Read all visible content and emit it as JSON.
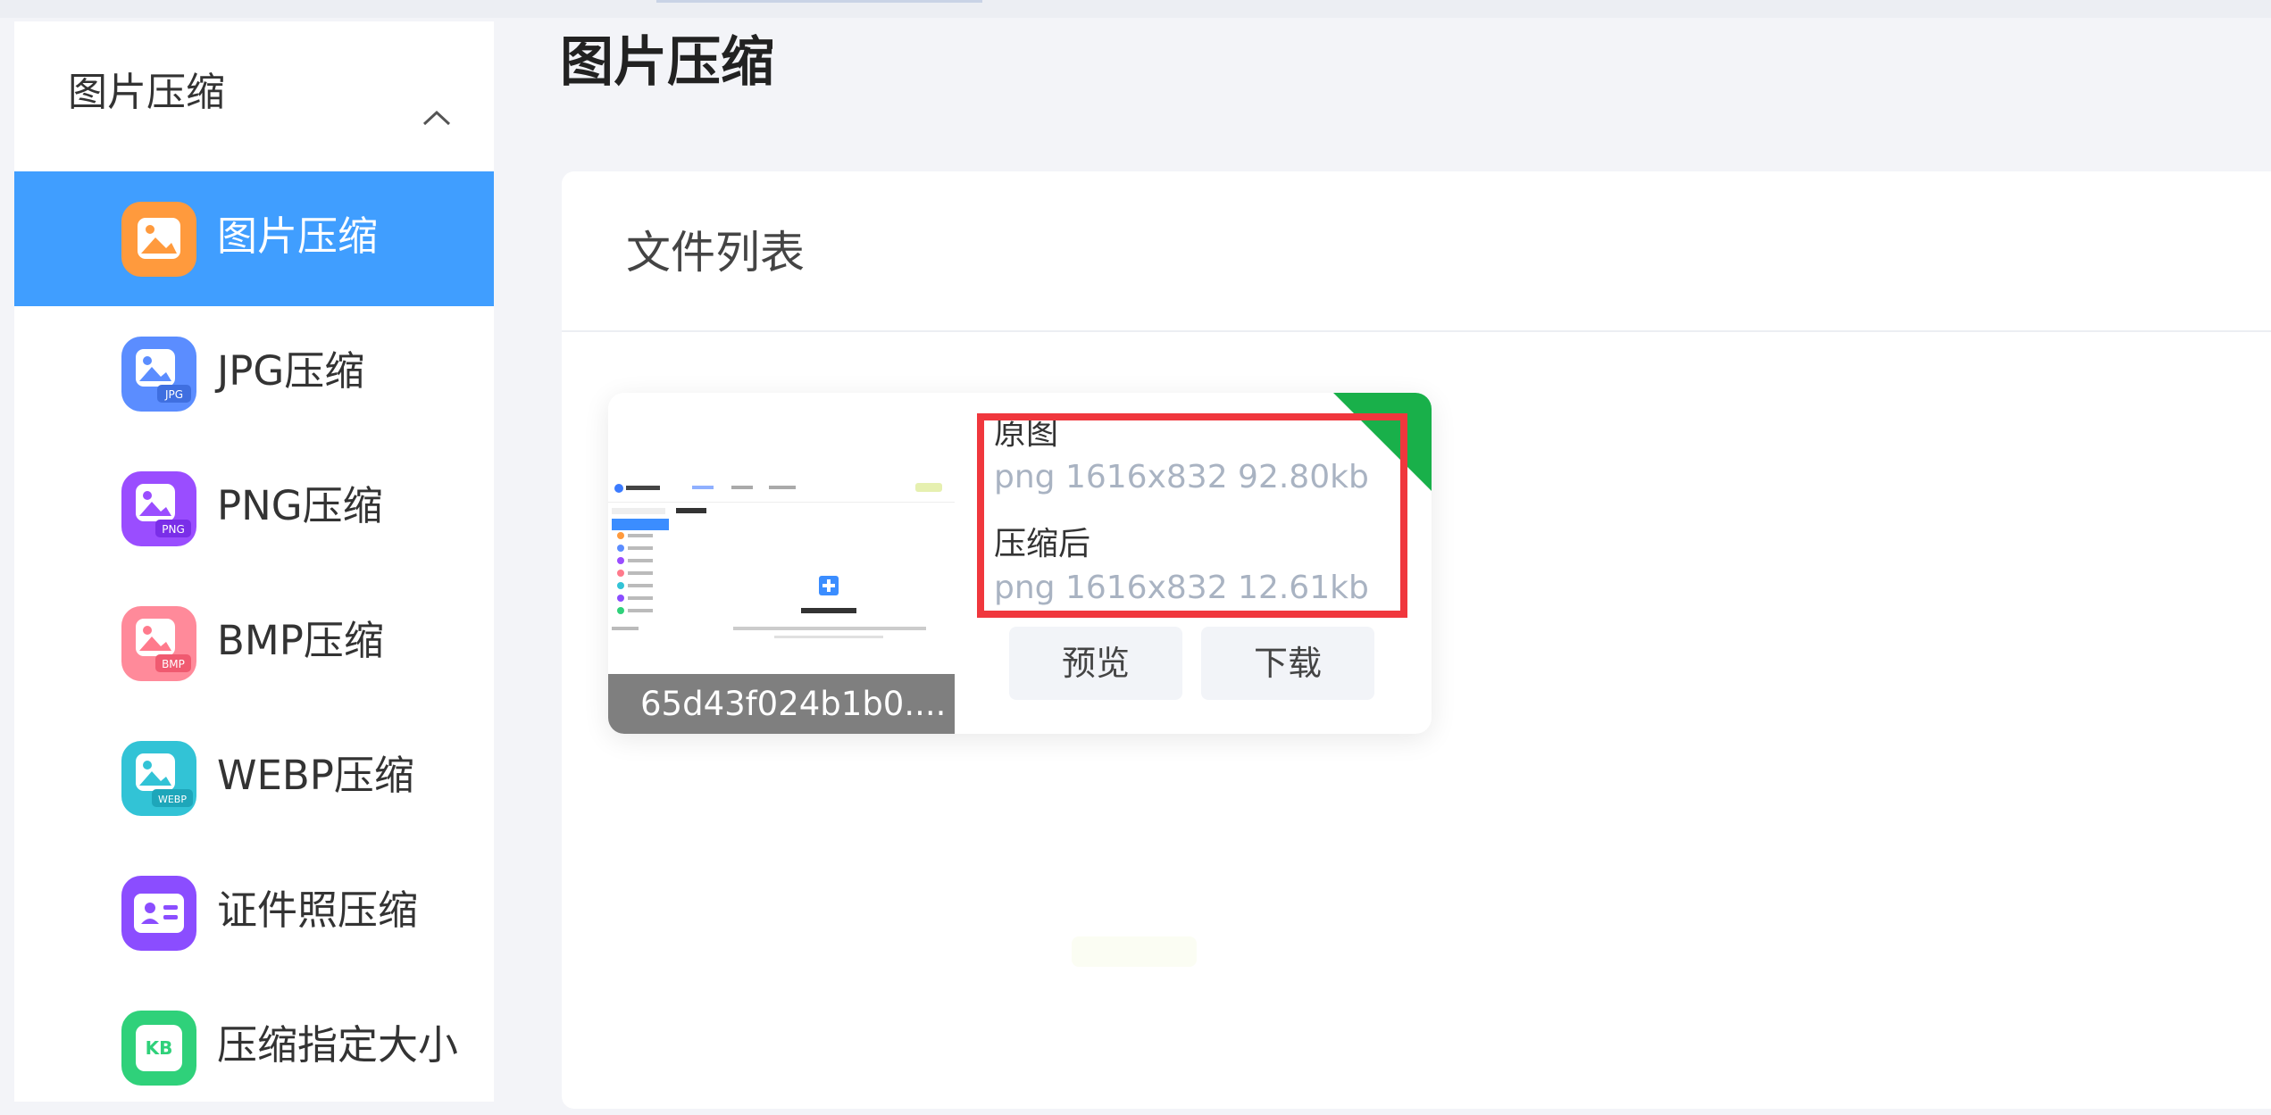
{
  "sidebar": {
    "header_title": "图片压缩",
    "items": [
      {
        "label": "图片压缩",
        "icon": "image-compress-icon",
        "badge": "",
        "color": "#ff9a3d",
        "active": true
      },
      {
        "label": "JPG压缩",
        "icon": "jpg-compress-icon",
        "badge": "JPG",
        "color": "#5b8dff",
        "active": false
      },
      {
        "label": "PNG压缩",
        "icon": "png-compress-icon",
        "badge": "PNG",
        "color": "#9a4dff",
        "active": false
      },
      {
        "label": "BMP压缩",
        "icon": "bmp-compress-icon",
        "badge": "BMP",
        "color": "#ff7a8c",
        "active": false
      },
      {
        "label": "WEBP压缩",
        "icon": "webp-compress-icon",
        "badge": "WEBP",
        "color": "#32c3d6",
        "active": false
      },
      {
        "label": "证件照压缩",
        "icon": "id-photo-compress-icon",
        "badge": "",
        "color": "#8b4dff",
        "active": false
      },
      {
        "label": "压缩指定大小",
        "icon": "size-compress-icon",
        "badge": "KB",
        "color": "#2fd17a",
        "active": false
      }
    ]
  },
  "main": {
    "title": "图片压缩",
    "panel_title": "文件列表",
    "file": {
      "name": "65d43f024b1b0....",
      "original_label": "原图",
      "original_meta": "png  1616x832  92.80kb",
      "compressed_label": "压缩后",
      "compressed_meta": "png  1616x832  12.61kb",
      "preview_button": "预览",
      "download_button": "下载",
      "status_color": "#19b04a"
    }
  },
  "colors": {
    "active_bg": "#409eff",
    "highlight_border": "#f0373d"
  }
}
